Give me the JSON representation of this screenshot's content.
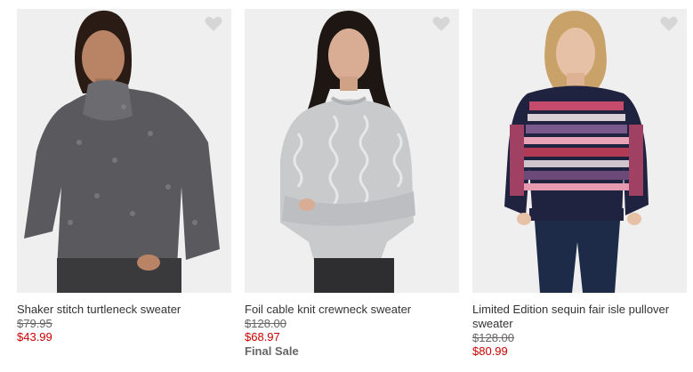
{
  "colors": {
    "sale_price": "#cc0000",
    "text": "#333333",
    "muted": "#666666",
    "photo_background": "#f1f1f1",
    "favorite_icon": "#d6d6d6"
  },
  "products": [
    {
      "name": "Shaker stitch turtleneck sweater",
      "original_price": "$79.95",
      "sale_price": "$43.99",
      "tag": "",
      "favorite_icon": "heart-icon"
    },
    {
      "name": "Foil cable knit crewneck sweater",
      "original_price": "$128.00",
      "sale_price": "$68.97",
      "tag": "Final Sale",
      "favorite_icon": "heart-icon"
    },
    {
      "name": "Limited Edition sequin fair isle pullover sweater",
      "original_price": "$128.00",
      "sale_price": "$80.99",
      "tag": "",
      "favorite_icon": "heart-icon"
    }
  ]
}
